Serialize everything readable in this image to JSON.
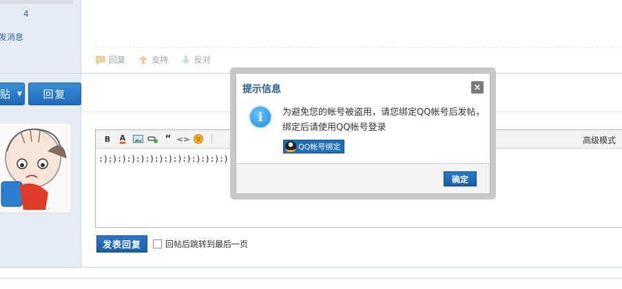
{
  "sidebar": {
    "count": "4",
    "send_message": "发消息"
  },
  "post_actions": {
    "reply": "回复",
    "support": "支持",
    "oppose": "反对"
  },
  "buttons": {
    "post_fragment": "贴",
    "reply": "回复"
  },
  "editor": {
    "toolbar_bold": "B",
    "toolbar_font_color": "A",
    "toolbar_quote": "“",
    "toolbar_code": "<>",
    "advanced_mode": "高级模式",
    "content": ":):):):):):):):):):):):):):):):):)"
  },
  "submit": {
    "label": "发表回复",
    "jump_label": "回帖后跳转到最后一页"
  },
  "dialog": {
    "title": "提示信息",
    "close": "×",
    "message": "为避免您的帐号被盗用，请您绑定QQ帐号后发帖，绑定后请使用QQ帐号登录",
    "qq_bind_label": "QQ帐号绑定",
    "ok_label": "确定"
  },
  "colors": {
    "accent": "#1e6bb8",
    "title": "#285c8e",
    "link": "#336699"
  },
  "icons": [
    "reply-icon",
    "support-icon",
    "oppose-icon",
    "info-icon",
    "qq-penguin-icon",
    "close-icon",
    "emoji-icon",
    "image-icon",
    "link-icon"
  ]
}
